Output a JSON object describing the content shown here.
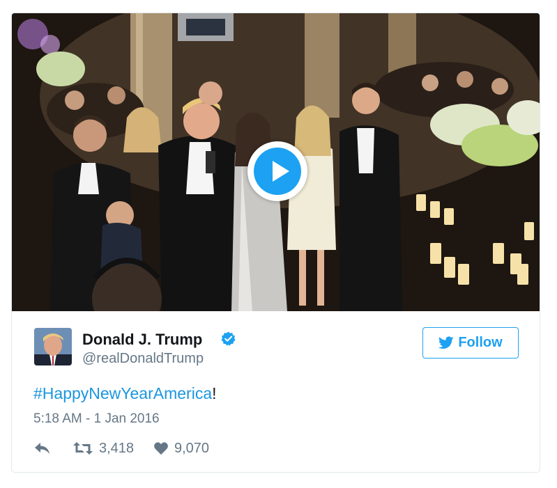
{
  "tweet": {
    "author_name": "Donald J. Trump",
    "author_handle": "@realDonaldTrump",
    "verified": true,
    "follow_label": "Follow",
    "text_hashtag": "#HappyNewYearAmerica",
    "text_suffix": "!",
    "timestamp": "5:18 AM - 1 Jan 2016",
    "retweets": "3,418",
    "likes": "9,070"
  },
  "media": {
    "type": "video",
    "play_icon": "play-icon"
  },
  "colors": {
    "accent": "#1da1f2",
    "link": "#1b95e0",
    "text": "#14171a",
    "secondary": "#657786",
    "border": "#e1e8ed"
  },
  "icons": [
    "verified-icon",
    "twitter-bird-icon",
    "reply-icon",
    "retweet-icon",
    "heart-icon"
  ]
}
